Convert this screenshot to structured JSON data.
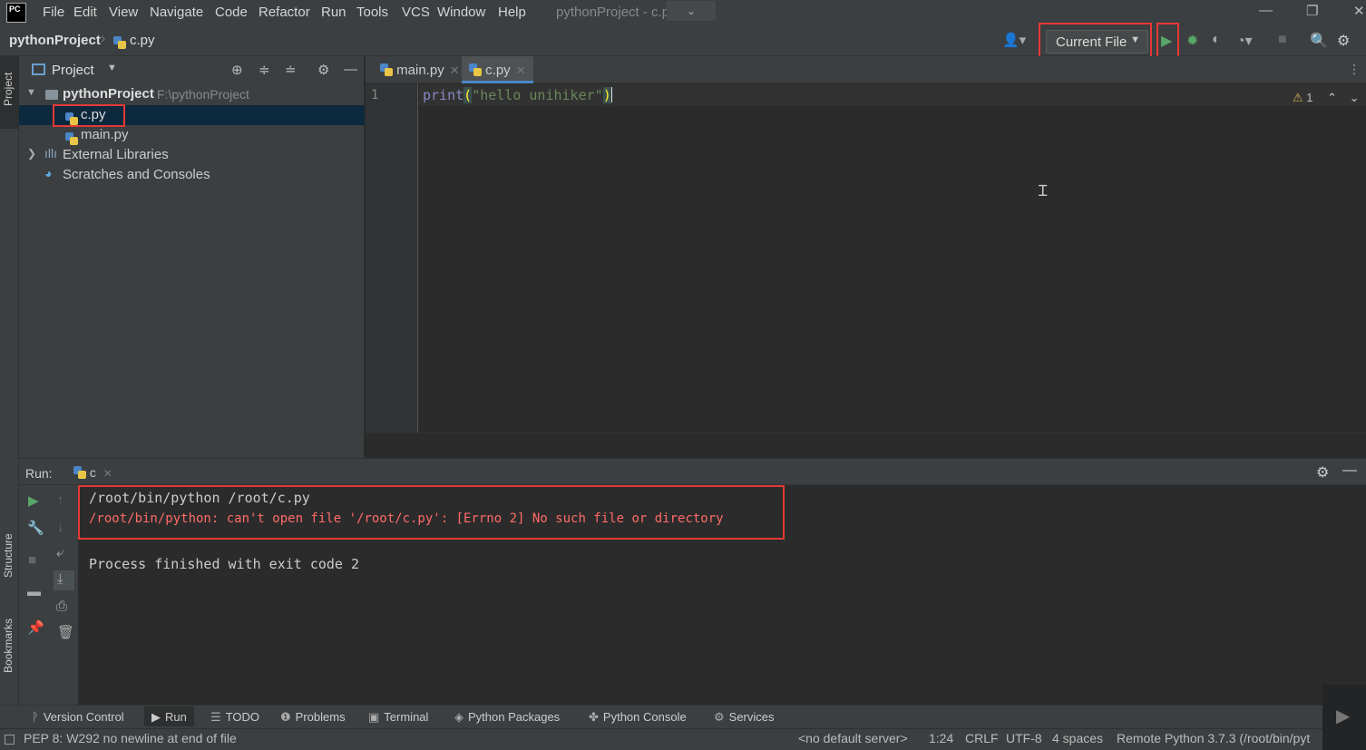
{
  "app": {
    "logo_text": "PC",
    "window_title": "pythonProject - c.py",
    "title_dropdown_glyph": "⌄",
    "window_controls": {
      "minimize": "—",
      "restore": "❐",
      "close": "✕"
    }
  },
  "menu": [
    "File",
    "Edit",
    "View",
    "Navigate",
    "Code",
    "Refactor",
    "Run",
    "Tools",
    "VCS",
    "Window",
    "Help"
  ],
  "breadcrumb": {
    "project": "pythonProject",
    "file": "c.py"
  },
  "run_config": {
    "label": "Current File"
  },
  "project_panel": {
    "title": "Project",
    "root": {
      "name": "pythonProject",
      "path": "F:\\pythonProject"
    },
    "files": [
      "c.py",
      "main.py"
    ],
    "selected_file": "c.py",
    "external_libraries": "External Libraries",
    "scratches": "Scratches and Consoles"
  },
  "editor": {
    "tabs": [
      {
        "label": "main.py",
        "active": false
      },
      {
        "label": "c.py",
        "active": true
      }
    ],
    "line_number": "1",
    "code": {
      "fn": "print",
      "open": "(",
      "string": "\"hello unihiker\"",
      "close": ")"
    },
    "warnings_count": "1"
  },
  "side_tabs": {
    "project": "Project",
    "structure": "Structure",
    "bookmarks": "Bookmarks"
  },
  "run_panel": {
    "label": "Run:",
    "tab": "c",
    "console": {
      "command": "/root/bin/python /root/c.py",
      "error": "/root/bin/python: can't open file '/root/c.py': [Errno 2] No such file or directory",
      "exit": "Process finished with exit code 2"
    }
  },
  "bottom_tabs": [
    "Version Control",
    "Run",
    "TODO",
    "Problems",
    "Terminal",
    "Python Packages",
    "Python Console",
    "Services"
  ],
  "status_bar": {
    "message": "PEP 8: W292 no newline at end of file",
    "server": "<no default server>",
    "position": "1:24",
    "line_sep": "CRLF",
    "encoding": "UTF-8",
    "indent": "4 spaces",
    "interpreter": "Remote Python 3.7.3 (/root/bin/pyt"
  },
  "colors": {
    "accent": "#4a88c7",
    "error": "#ff6b68",
    "highlight": "#e53935",
    "run_green": "#59a869"
  }
}
